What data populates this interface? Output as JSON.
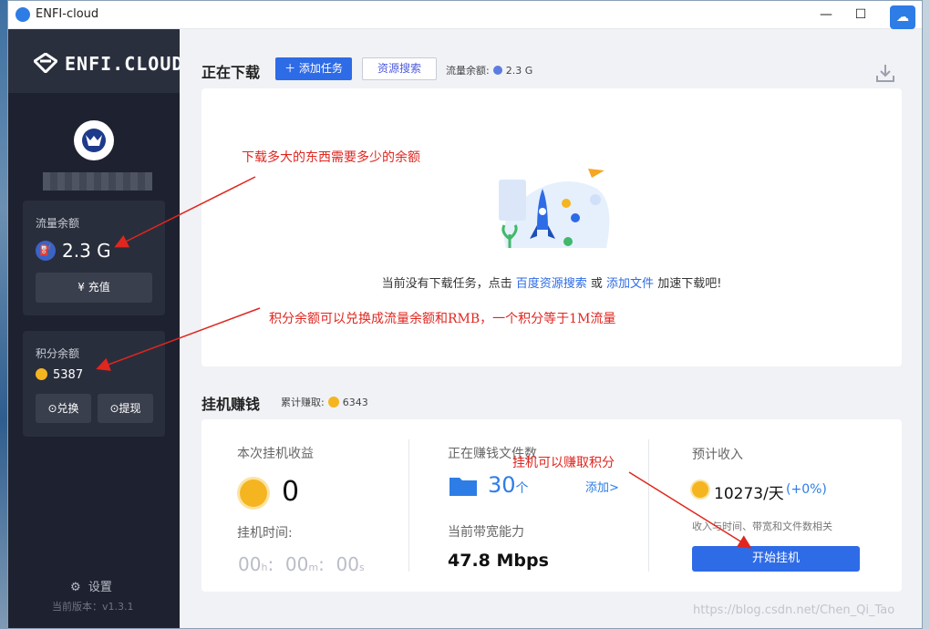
{
  "window": {
    "title": "ENFI-cloud",
    "minimize": "—",
    "maximize": "☐",
    "close": "✕"
  },
  "sidebar": {
    "logo_text": "ENFI.CLOUD",
    "traffic": {
      "label": "流量余额",
      "value": "2.3 G",
      "recharge_button": "充值"
    },
    "points": {
      "label": "积分余额",
      "value": "5387",
      "exchange_button": "兑换",
      "withdraw_button": "提现"
    },
    "settings_label": "设置",
    "version": "当前版本：v1.3.1"
  },
  "downloads": {
    "section_title": "正在下载",
    "add_task_button": "添加任务",
    "resource_search_button": "资源搜索",
    "traffic_label": "流量余额:",
    "traffic_value": "2.3 G",
    "empty_prefix": "当前没有下载任务，点击",
    "empty_link_search": "百度资源搜索",
    "empty_or": "或",
    "empty_link_add": "添加文件",
    "empty_suffix": "加速下载吧!"
  },
  "earn": {
    "section_title": "挂机赚钱",
    "total_label": "累计赚取:",
    "total_value": "6343",
    "session_label": "本次挂机收益",
    "session_value": "0",
    "time_label": "挂机时间:",
    "time_h": "00",
    "time_m": "00",
    "time_s": "00",
    "unit_h": "h",
    "unit_m": "m",
    "unit_s": "s",
    "files_label": "正在赚钱文件数",
    "files_count": "30",
    "files_unit": "个",
    "add_link": "添加>",
    "bandwidth_label": "当前带宽能力",
    "bandwidth_value": "47.8 Mbps",
    "expected_label": "预计收入",
    "expected_value": "10273/天",
    "expected_change": "(+0%)",
    "expected_note": "收入与时间、带宽和文件数相关",
    "start_button": "开始挂机"
  },
  "annotations": {
    "note_traffic": "下载多大的东西需要多少的余额",
    "note_points": "积分余额可以兑换成流量余额和RMB，一个积分等于1M流量",
    "note_earn": "挂机可以赚取积分",
    "color": "#e0261f"
  },
  "watermark": "https://blog.csdn.net/Chen_Qi_Tao",
  "colors": {
    "accent": "#2e6be6",
    "sidebar_bg": "#1e2230",
    "coin": "#f5b521"
  }
}
